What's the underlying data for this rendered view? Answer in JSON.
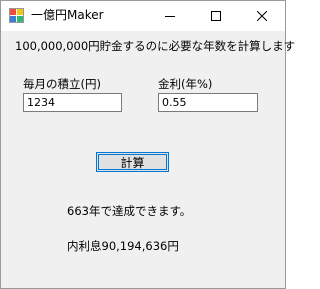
{
  "window": {
    "title": "一億円Maker"
  },
  "form": {
    "description": "100,000,000円貯金するのに必要な年数を計算します",
    "monthly_label": "毎月の積立(円)",
    "monthly_value": "1234",
    "rate_label": "金利(年%)",
    "rate_value": "0.55",
    "calc_button": "計算"
  },
  "result": {
    "years": "663年で達成できます。",
    "interest": "内利息90,194,636円"
  },
  "icons": [
    "app-icon",
    "minimize-icon",
    "maximize-icon",
    "close-icon"
  ]
}
